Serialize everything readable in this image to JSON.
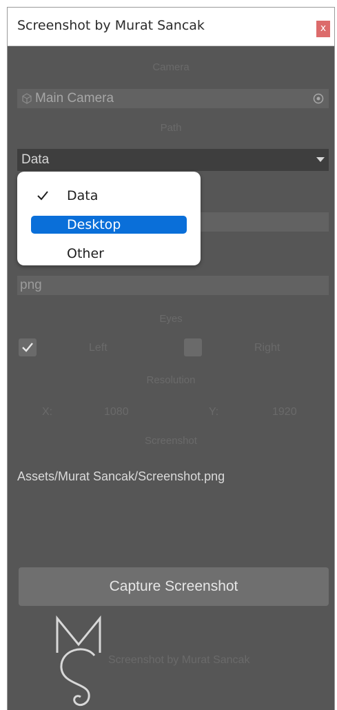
{
  "window": {
    "title": "Screenshot by Murat Sancak",
    "close_label": "x"
  },
  "camera": {
    "label": "Camera",
    "value": "Main Camera"
  },
  "path": {
    "label": "Path",
    "selected": "Data",
    "options": [
      {
        "label": "Data",
        "checked": true,
        "highlighted": false
      },
      {
        "label": "Desktop",
        "checked": false,
        "highlighted": true
      },
      {
        "label": "Other",
        "checked": false,
        "highlighted": false
      }
    ]
  },
  "format": {
    "value": "png"
  },
  "eyes": {
    "label": "Eyes",
    "left_label": "Left",
    "left_checked": true,
    "right_label": "Right",
    "right_checked": false
  },
  "resolution": {
    "label": "Resolution",
    "x_label": "X:",
    "x_value": "1080",
    "y_label": "Y:",
    "y_value": "1920"
  },
  "screenshot": {
    "label": "Screenshot",
    "path": "Assets/Murat Sancak/Screenshot.png"
  },
  "capture_button": {
    "label": "Capture Screenshot"
  },
  "footer": {
    "logo_text": "Screenshot by Murat Sancak"
  },
  "colors": {
    "panel_bg": "#565656",
    "accent": "#0a6fd9",
    "close_bg": "#dc6b6b"
  }
}
